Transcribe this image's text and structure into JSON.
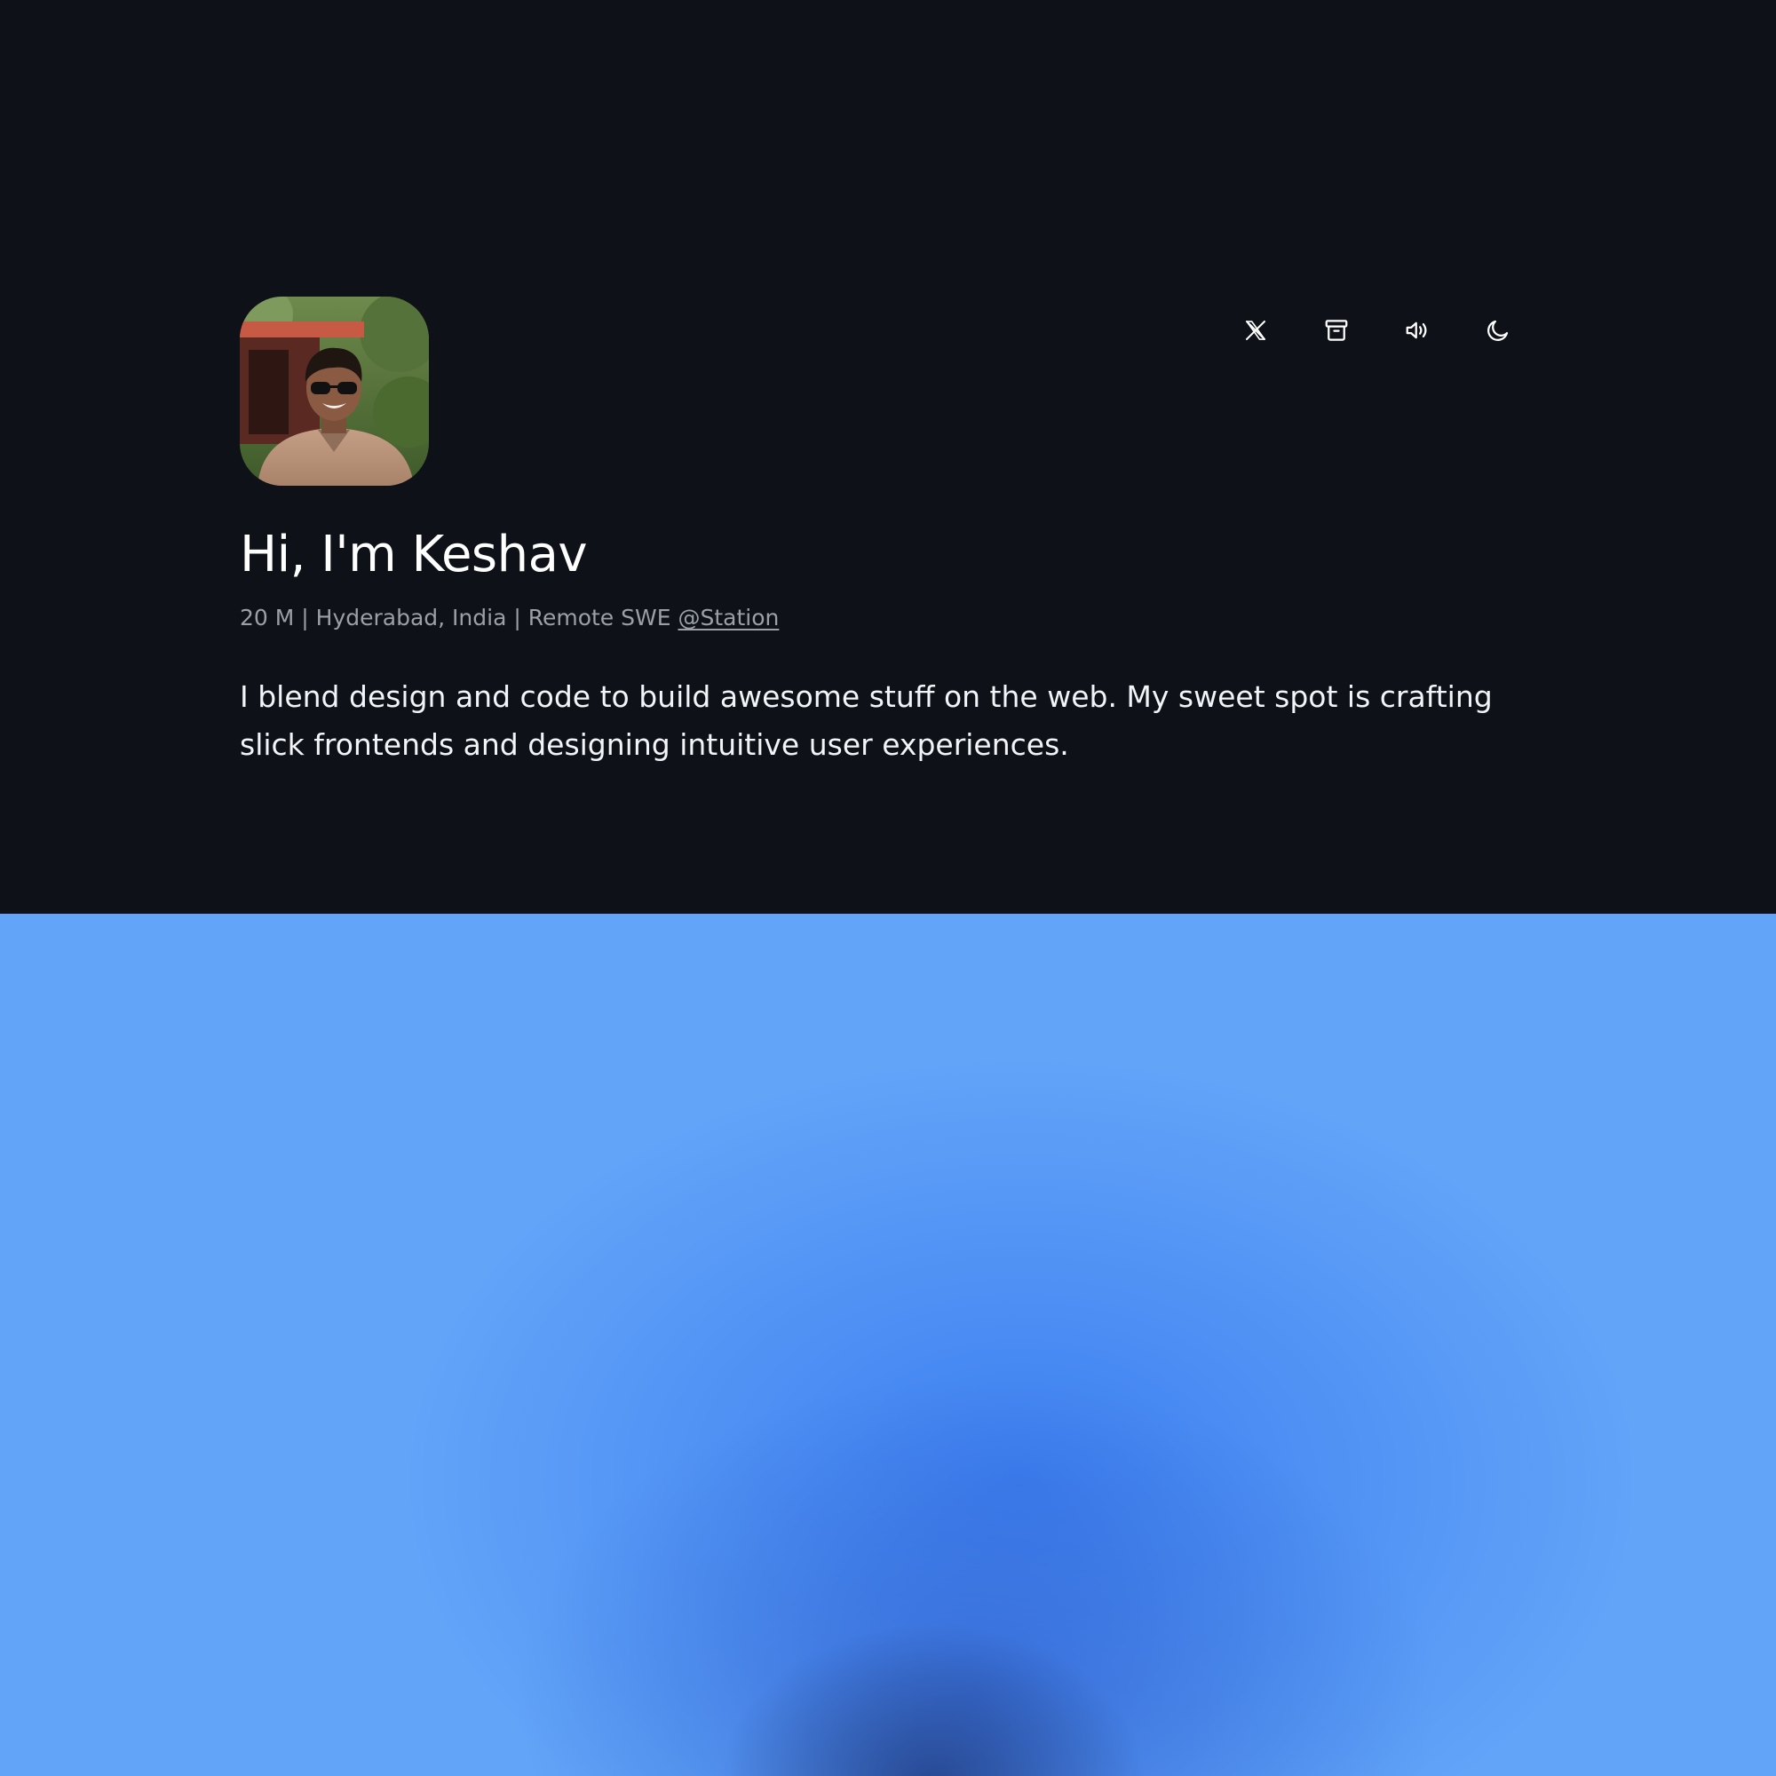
{
  "profile": {
    "title": "Hi, I'm Keshav",
    "meta_prefix": "20 M | Hyderabad, India | Remote SWE ",
    "meta_link": "@Station",
    "bio": "I blend design and code to build awesome stuff on the web. My sweet spot is crafting slick frontends and designing intuitive user experiences."
  },
  "toolbar": {
    "icons": [
      "x-twitter-icon",
      "archive-icon",
      "speaker-icon",
      "moon-icon"
    ]
  },
  "colors": {
    "background_dark": "#0e1218",
    "blue_section": "#62a4f8",
    "blue_deep": "#3b7df0",
    "meta_text": "#9ba0a8"
  }
}
